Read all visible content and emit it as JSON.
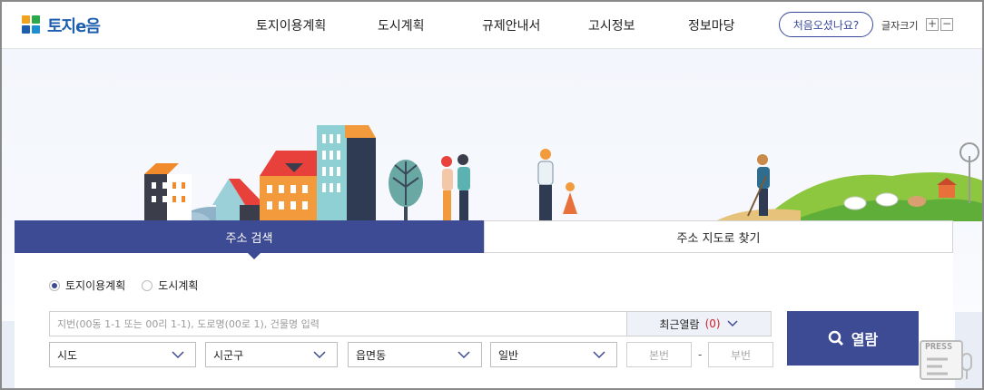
{
  "header": {
    "logo": "토지e음",
    "nav": [
      "토지이용계획",
      "도시계획",
      "규제안내서",
      "고시정보",
      "정보마당"
    ],
    "first_visit_button": "처음오셨나요?",
    "font_size_label": "글자크기",
    "font_plus": "+",
    "font_minus": "−"
  },
  "search": {
    "tabs": {
      "active": "주소 검색",
      "inactive": "주소 지도로 찾기"
    },
    "radio_options": [
      {
        "label": "토지이용계획",
        "selected": true
      },
      {
        "label": "도시계획",
        "selected": false
      }
    ],
    "address_placeholder": "지번(00동 1-1 또는 00리 1-1), 도로명(00로 1), 건물명 입력",
    "recent_label": "최근열람",
    "recent_count": "(0)",
    "selects": [
      "시도",
      "시군구",
      "읍면동",
      "일반"
    ],
    "main_number_placeholder": "본번",
    "sub_number_placeholder": "부번",
    "dash": "-",
    "open_button": "열람"
  },
  "watermark": "PRESS",
  "colors": {
    "primary": "#3d4a94",
    "accent_red": "#d0202a",
    "logo_blue": "#1d5fae",
    "logo_green": "#2aa84a"
  }
}
